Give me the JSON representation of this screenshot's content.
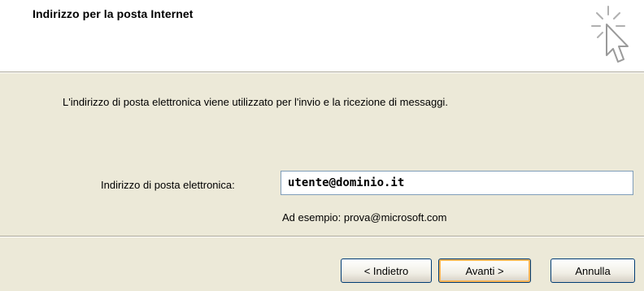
{
  "header": {
    "title": "Indirizzo per la posta Internet",
    "icon": "wizard-cursor-icon"
  },
  "content": {
    "description": "L'indirizzo di posta elettronica viene utilizzato per l'invio e la ricezione di messaggi.",
    "email_label": "Indirizzo di posta elettronica:",
    "email_value": "utente@dominio.it",
    "example": "Ad esempio: prova@microsoft.com"
  },
  "buttons": {
    "back_label": "< Indietro",
    "next_label": "Avanti >",
    "cancel_label": "Annulla"
  },
  "colors": {
    "header_bg": "#ffffff",
    "dialog_bg": "#ece9d8",
    "button_border": "#003c74",
    "default_focus": "#f7b455"
  }
}
